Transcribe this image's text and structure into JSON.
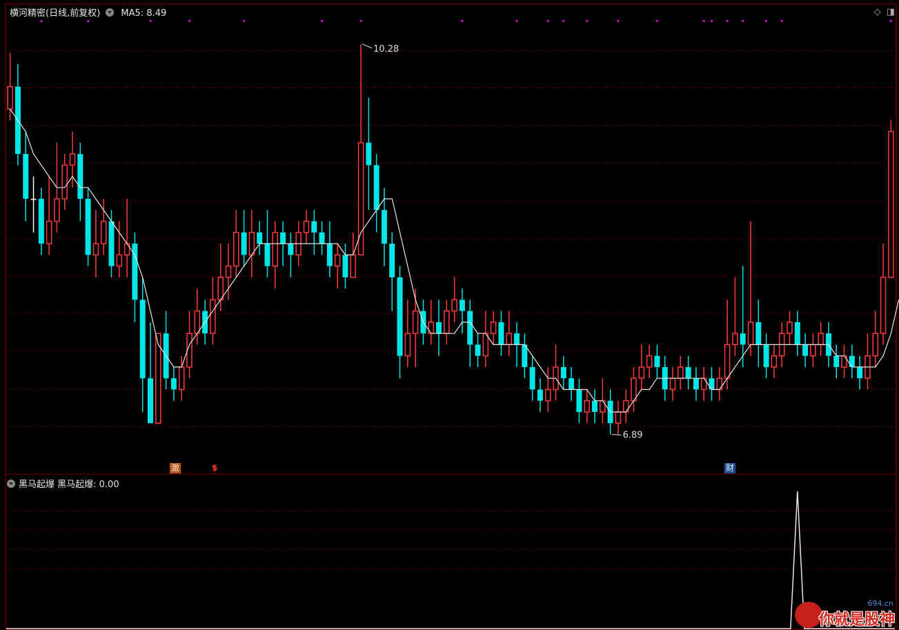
{
  "header": {
    "title": "横河精密(日线,前复权)",
    "ma_label": "MA5: 8.49",
    "icons": [
      "diamond-icon",
      "window-icon"
    ]
  },
  "indicator": {
    "label": "黑马起爆  黑马起爆: 0.00"
  },
  "tags": {
    "ji": "激",
    "s": "$",
    "cai": "财"
  },
  "watermark": {
    "domain": "694.cn",
    "text": "你就是股神"
  },
  "colors": {
    "up": "#ff3b3b",
    "down": "#00e5e5",
    "doji": "#ffffff",
    "ma": "#e8e8e8",
    "grid": "#7a0000",
    "marker": "#d400d4",
    "frame": "#8a0000"
  },
  "chart_data": {
    "type": "candlestick",
    "series_name": "MA5",
    "price_range": [
      6.6,
      10.5
    ],
    "high_label": "10.28",
    "low_label": "6.89",
    "candles": [
      [
        9.7,
        9.9,
        9.6,
        10.2
      ],
      [
        9.9,
        9.3,
        9.2,
        10.1
      ],
      [
        9.3,
        8.9,
        8.7,
        9.5
      ],
      [
        8.9,
        8.9,
        8.6,
        9.1
      ],
      [
        8.9,
        8.5,
        8.4,
        9.0
      ],
      [
        8.5,
        8.7,
        8.4,
        9.1
      ],
      [
        8.7,
        8.9,
        8.6,
        9.4
      ],
      [
        8.9,
        9.2,
        8.8,
        9.3
      ],
      [
        9.2,
        9.3,
        9.0,
        9.5
      ],
      [
        9.3,
        8.9,
        8.7,
        9.4
      ],
      [
        8.9,
        8.4,
        8.3,
        9.0
      ],
      [
        8.4,
        8.5,
        8.2,
        8.8
      ],
      [
        8.5,
        8.7,
        8.4,
        8.9
      ],
      [
        8.7,
        8.3,
        8.2,
        8.8
      ],
      [
        8.3,
        8.4,
        8.2,
        8.7
      ],
      [
        8.4,
        8.5,
        8.2,
        8.9
      ],
      [
        8.5,
        8.0,
        7.8,
        8.6
      ],
      [
        8.0,
        7.3,
        7.0,
        8.2
      ],
      [
        7.3,
        6.9,
        6.9,
        7.8
      ],
      [
        6.9,
        7.7,
        6.9,
        7.7
      ],
      [
        7.7,
        7.3,
        7.2,
        7.9
      ],
      [
        7.3,
        7.2,
        7.1,
        7.4
      ],
      [
        7.2,
        7.4,
        7.1,
        7.5
      ],
      [
        7.4,
        7.7,
        7.3,
        7.9
      ],
      [
        7.7,
        7.9,
        7.6,
        8.1
      ],
      [
        7.9,
        7.7,
        7.6,
        8.0
      ],
      [
        7.7,
        8.0,
        7.6,
        8.2
      ],
      [
        8.0,
        8.2,
        7.9,
        8.5
      ],
      [
        8.2,
        8.3,
        8.0,
        8.5
      ],
      [
        8.3,
        8.6,
        8.2,
        8.8
      ],
      [
        8.6,
        8.4,
        8.3,
        8.8
      ],
      [
        8.4,
        8.6,
        8.2,
        8.8
      ],
      [
        8.6,
        8.5,
        8.4,
        8.7
      ],
      [
        8.5,
        8.3,
        8.2,
        8.8
      ],
      [
        8.3,
        8.6,
        8.1,
        8.7
      ],
      [
        8.6,
        8.5,
        8.3,
        8.7
      ],
      [
        8.5,
        8.4,
        8.2,
        8.6
      ],
      [
        8.4,
        8.6,
        8.3,
        8.7
      ],
      [
        8.6,
        8.7,
        8.5,
        8.8
      ],
      [
        8.7,
        8.6,
        8.4,
        8.8
      ],
      [
        8.6,
        8.5,
        8.4,
        8.7
      ],
      [
        8.5,
        8.3,
        8.2,
        8.7
      ],
      [
        8.3,
        8.4,
        8.1,
        8.5
      ],
      [
        8.4,
        8.2,
        8.1,
        8.5
      ],
      [
        8.2,
        8.4,
        8.2,
        8.6
      ],
      [
        8.4,
        9.4,
        8.4,
        10.28
      ],
      [
        9.4,
        9.2,
        8.8,
        9.8
      ],
      [
        9.2,
        8.8,
        8.6,
        9.3
      ],
      [
        8.8,
        8.5,
        8.3,
        9.0
      ],
      [
        8.5,
        8.2,
        7.9,
        8.6
      ],
      [
        8.2,
        7.5,
        7.3,
        8.3
      ],
      [
        7.5,
        7.7,
        7.4,
        8.0
      ],
      [
        7.7,
        7.9,
        7.4,
        8.1
      ],
      [
        7.9,
        7.7,
        7.6,
        8.0
      ],
      [
        7.7,
        7.8,
        7.6,
        8.0
      ],
      [
        7.8,
        7.7,
        7.5,
        8.0
      ],
      [
        7.7,
        7.9,
        7.6,
        8.0
      ],
      [
        7.9,
        8.0,
        7.8,
        8.2
      ],
      [
        8.0,
        7.9,
        7.7,
        8.1
      ],
      [
        7.9,
        7.6,
        7.4,
        8.0
      ],
      [
        7.6,
        7.5,
        7.4,
        7.7
      ],
      [
        7.5,
        7.7,
        7.4,
        7.9
      ],
      [
        7.7,
        7.8,
        7.6,
        7.9
      ],
      [
        7.8,
        7.6,
        7.5,
        7.9
      ],
      [
        7.6,
        7.7,
        7.5,
        7.9
      ],
      [
        7.7,
        7.6,
        7.4,
        7.8
      ],
      [
        7.6,
        7.4,
        7.3,
        7.7
      ],
      [
        7.4,
        7.2,
        7.1,
        7.5
      ],
      [
        7.2,
        7.1,
        7.0,
        7.3
      ],
      [
        7.1,
        7.2,
        7.0,
        7.4
      ],
      [
        7.2,
        7.4,
        7.1,
        7.6
      ],
      [
        7.4,
        7.3,
        7.2,
        7.5
      ],
      [
        7.3,
        7.2,
        7.1,
        7.4
      ],
      [
        7.2,
        7.0,
        6.9,
        7.3
      ],
      [
        7.0,
        7.1,
        6.9,
        7.2
      ],
      [
        7.1,
        7.0,
        6.9,
        7.2
      ],
      [
        7.0,
        7.1,
        6.9,
        7.3
      ],
      [
        7.1,
        6.9,
        6.8,
        7.2
      ],
      [
        6.9,
        7.0,
        6.8,
        7.1
      ],
      [
        7.0,
        7.1,
        6.9,
        7.2
      ],
      [
        7.1,
        7.3,
        7.0,
        7.4
      ],
      [
        7.3,
        7.4,
        7.2,
        7.6
      ],
      [
        7.4,
        7.5,
        7.3,
        7.6
      ],
      [
        7.5,
        7.4,
        7.3,
        7.6
      ],
      [
        7.4,
        7.2,
        7.1,
        7.5
      ],
      [
        7.2,
        7.3,
        7.1,
        7.4
      ],
      [
        7.3,
        7.4,
        7.2,
        7.5
      ],
      [
        7.4,
        7.3,
        7.2,
        7.5
      ],
      [
        7.3,
        7.2,
        7.1,
        7.4
      ],
      [
        7.2,
        7.3,
        7.1,
        7.4
      ],
      [
        7.3,
        7.2,
        7.1,
        7.4
      ],
      [
        7.2,
        7.3,
        7.1,
        7.4
      ],
      [
        7.3,
        7.6,
        7.2,
        8.0
      ],
      [
        7.6,
        7.7,
        7.5,
        8.2
      ],
      [
        7.7,
        7.6,
        7.4,
        8.3
      ],
      [
        7.6,
        7.8,
        7.5,
        8.7
      ],
      [
        7.8,
        7.6,
        7.4,
        8.0
      ],
      [
        7.6,
        7.4,
        7.3,
        7.7
      ],
      [
        7.4,
        7.5,
        7.3,
        7.6
      ],
      [
        7.5,
        7.7,
        7.4,
        7.8
      ],
      [
        7.7,
        7.8,
        7.6,
        7.9
      ],
      [
        7.8,
        7.6,
        7.5,
        7.9
      ],
      [
        7.6,
        7.5,
        7.4,
        7.7
      ],
      [
        7.5,
        7.6,
        7.4,
        7.7
      ],
      [
        7.6,
        7.7,
        7.5,
        7.8
      ],
      [
        7.7,
        7.5,
        7.4,
        7.8
      ],
      [
        7.5,
        7.4,
        7.3,
        7.6
      ],
      [
        7.4,
        7.5,
        7.3,
        7.6
      ],
      [
        7.5,
        7.4,
        7.3,
        7.6
      ],
      [
        7.4,
        7.3,
        7.2,
        7.5
      ],
      [
        7.3,
        7.5,
        7.2,
        7.7
      ],
      [
        7.5,
        7.7,
        7.4,
        7.9
      ],
      [
        7.7,
        8.2,
        7.6,
        8.5
      ],
      [
        8.2,
        9.5,
        8.2,
        9.6
      ]
    ],
    "ma5": [
      9.7,
      9.6,
      9.5,
      9.3,
      9.2,
      9.1,
      9.0,
      9.0,
      9.1,
      9.0,
      9.0,
      8.9,
      8.8,
      8.7,
      8.6,
      8.5,
      8.4,
      8.2,
      7.9,
      7.6,
      7.5,
      7.4,
      7.4,
      7.6,
      7.7,
      7.8,
      7.9,
      8.0,
      8.1,
      8.2,
      8.3,
      8.4,
      8.5,
      8.5,
      8.5,
      8.5,
      8.5,
      8.5,
      8.5,
      8.5,
      8.5,
      8.5,
      8.5,
      8.4,
      8.4,
      8.6,
      8.7,
      8.8,
      8.9,
      8.9,
      8.6,
      8.3,
      8.0,
      7.8,
      7.7,
      7.7,
      7.7,
      7.7,
      7.8,
      7.8,
      7.7,
      7.7,
      7.6,
      7.6,
      7.6,
      7.6,
      7.6,
      7.5,
      7.4,
      7.3,
      7.3,
      7.2,
      7.2,
      7.2,
      7.2,
      7.1,
      7.1,
      7.0,
      7.0,
      7.0,
      7.1,
      7.2,
      7.2,
      7.3,
      7.3,
      7.3,
      7.3,
      7.3,
      7.3,
      7.3,
      7.2,
      7.2,
      7.3,
      7.4,
      7.5,
      7.6,
      7.6,
      7.6,
      7.6,
      7.6,
      7.6,
      7.6,
      7.6,
      7.6,
      7.6,
      7.6,
      7.5,
      7.5,
      7.4,
      7.4,
      7.4,
      7.4,
      7.5,
      7.7,
      8.0
    ],
    "marker_dot_indexes": [
      4,
      10,
      18,
      23,
      30,
      40,
      45,
      58,
      65,
      69,
      71,
      74,
      78,
      83,
      89,
      90,
      92,
      94,
      97,
      99,
      113,
      118
    ],
    "indicator_values_spike_index": 101,
    "indicator_values": {
      "peak": 1.0,
      "current": 0.0
    }
  }
}
